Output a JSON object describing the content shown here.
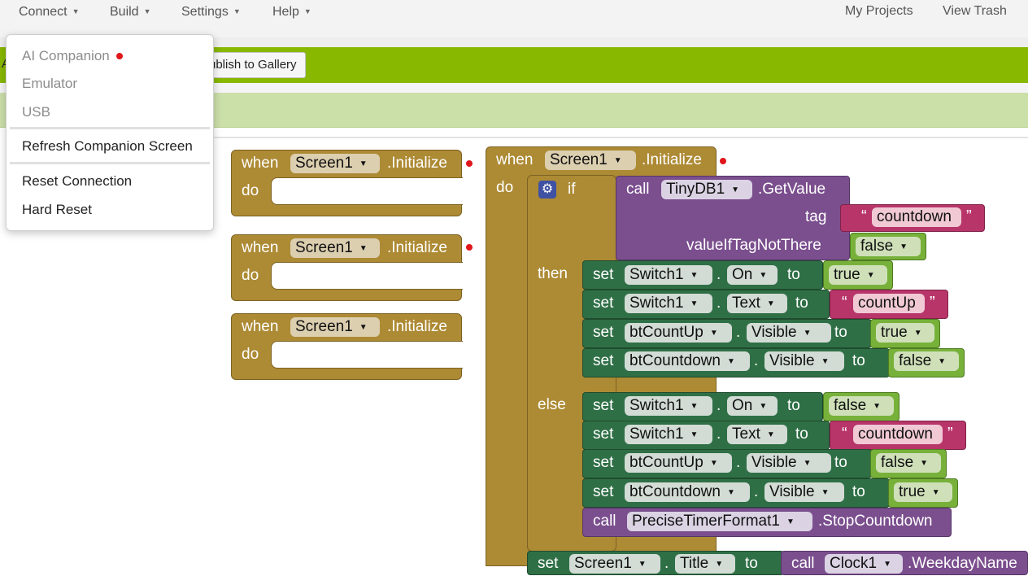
{
  "menu": {
    "connect": "Connect",
    "build": "Build",
    "settings": "Settings",
    "help": "Help",
    "my_projects": "My Projects",
    "view_trash": "View Trash"
  },
  "toolbar": {
    "partial_left": "A",
    "publish": "ublish to Gallery"
  },
  "connect_menu": {
    "ai_companion": "AI Companion",
    "emulator": "Emulator",
    "usb": "USB",
    "refresh": "Refresh Companion Screen",
    "reset": "Reset Connection",
    "hard_reset": "Hard Reset"
  },
  "blocks": {
    "when": "when",
    "do": "do",
    "screen": "Screen1",
    "initialize": ".Initialize",
    "if": "if",
    "then": "then",
    "else": "else",
    "call": "call",
    "set": "set",
    "to": "to",
    "dot": ".",
    "tinydb": "TinyDB1",
    "getvalue": ".GetValue",
    "tag": "tag",
    "value_if_tag_not_there": "valueIfTagNotThere",
    "countdown_str": "countdown",
    "countup_str": "countUp",
    "true": "true",
    "false": "false",
    "switch1": "Switch1",
    "on": "On",
    "text": "Text",
    "btcountup": "btCountUp",
    "btcountdown": "btCountdown",
    "visible": "Visible",
    "precise_timer": "PreciseTimerFormat1",
    "stop_countdown": ".StopCountdown",
    "title": "Title",
    "clock1": "Clock1",
    "weekday_name": ".WeekdayName",
    "open_quote": "“",
    "close_quote": "”"
  },
  "colors": {
    "event": "#ad8a34",
    "toolbar": "#88b800",
    "setter": "#2f6f46",
    "procedure": "#7b4f8e",
    "logic": "#77b13a",
    "text": "#b8356a",
    "warning_dot": "#e0161b"
  }
}
